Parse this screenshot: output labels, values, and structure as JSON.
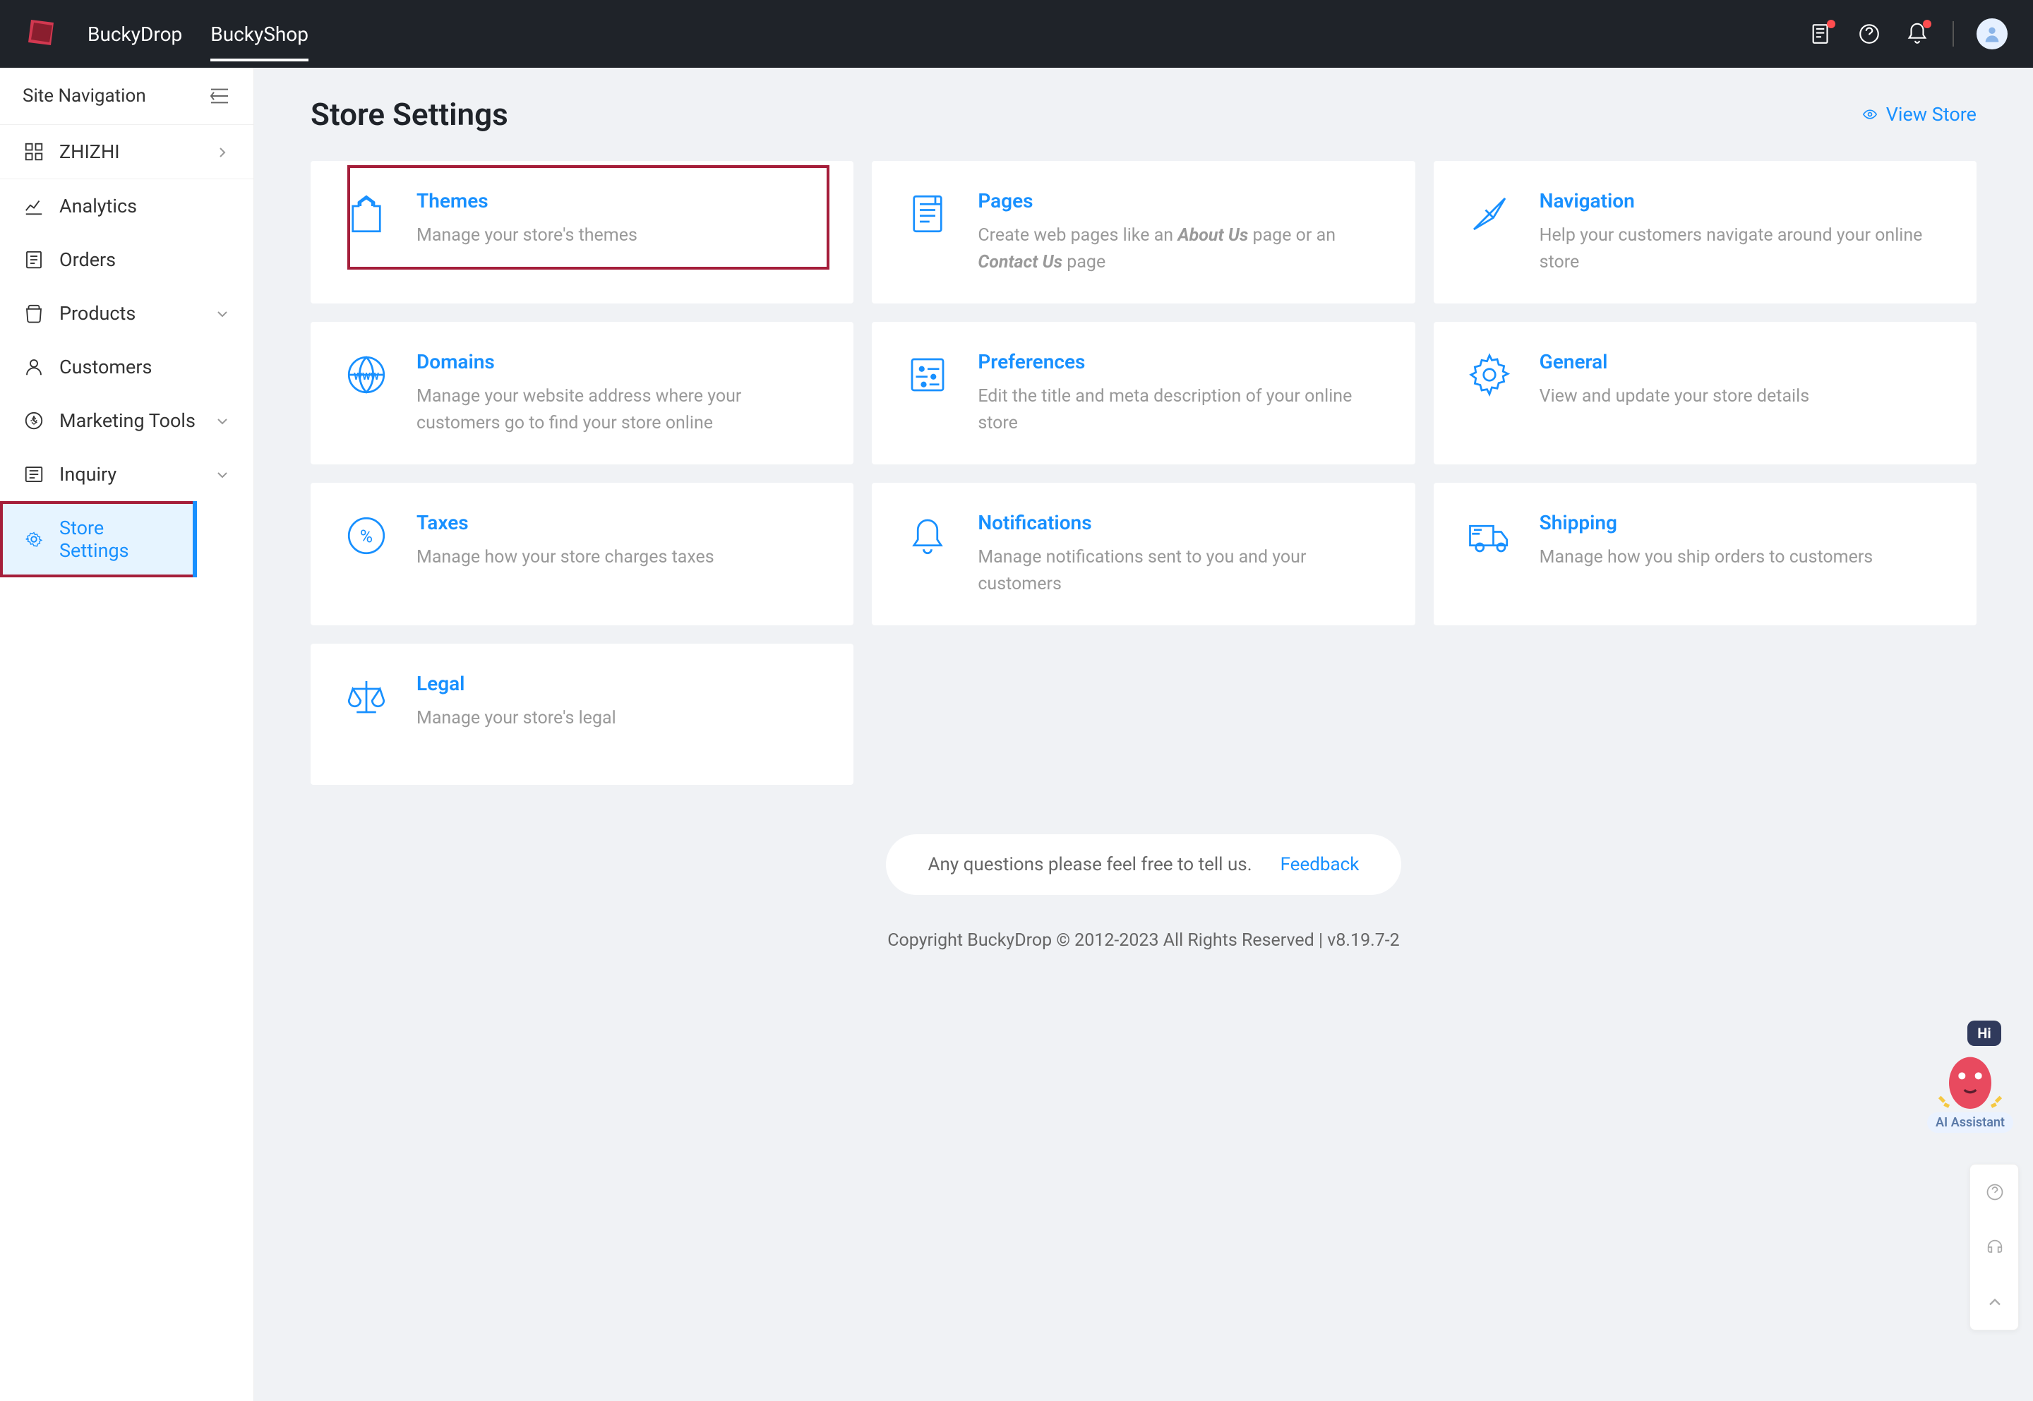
{
  "header": {
    "tabs": [
      "BuckyDrop",
      "BuckyShop"
    ],
    "activeTab": 1
  },
  "sidebar": {
    "title": "Site Navigation",
    "items": [
      {
        "icon": "grid",
        "label": "ZHIZHI",
        "chevron": "right"
      },
      {
        "icon": "analytics",
        "label": "Analytics"
      },
      {
        "icon": "orders",
        "label": "Orders"
      },
      {
        "icon": "products",
        "label": "Products",
        "chevron": "down"
      },
      {
        "icon": "customers",
        "label": "Customers"
      },
      {
        "icon": "marketing",
        "label": "Marketing Tools",
        "chevron": "down"
      },
      {
        "icon": "inquiry",
        "label": "Inquiry",
        "chevron": "down"
      },
      {
        "icon": "settings",
        "label": "Store Settings",
        "active": true,
        "highlight": true
      }
    ]
  },
  "page": {
    "title": "Store Settings",
    "viewStore": "View Store"
  },
  "cards": [
    {
      "icon": "themes",
      "title": "Themes",
      "desc": "Manage your store's themes",
      "highlight": true
    },
    {
      "icon": "pages",
      "title": "Pages",
      "desc_html": "Create web pages like an <span class='strong'>About Us</span> page or an <span class='strong'>Contact Us</span> page"
    },
    {
      "icon": "nav",
      "title": "Navigation",
      "desc": "Help your customers navigate around your online store"
    },
    {
      "icon": "domains",
      "title": "Domains",
      "desc": "Manage your website address where your customers go to find your store online"
    },
    {
      "icon": "prefs",
      "title": "Preferences",
      "desc": "Edit the title and meta description of your online store"
    },
    {
      "icon": "general",
      "title": "General",
      "desc": "View and update your store details"
    },
    {
      "icon": "taxes",
      "title": "Taxes",
      "desc": "Manage how your store charges taxes"
    },
    {
      "icon": "notif",
      "title": "Notifications",
      "desc": "Manage notifications sent to you and your customers"
    },
    {
      "icon": "shipping",
      "title": "Shipping",
      "desc": "Manage how you ship orders to customers"
    },
    {
      "icon": "legal",
      "title": "Legal",
      "desc": "Manage your store's legal"
    }
  ],
  "footer": {
    "helpText": "Any questions please feel free to tell us.",
    "feedback": "Feedback",
    "copyright": "Copyright BuckyDrop © 2012-2023 All Rights Reserved | v8.19.7-2"
  },
  "ai": {
    "bubble": "Hi",
    "label": "AI Assistant"
  }
}
